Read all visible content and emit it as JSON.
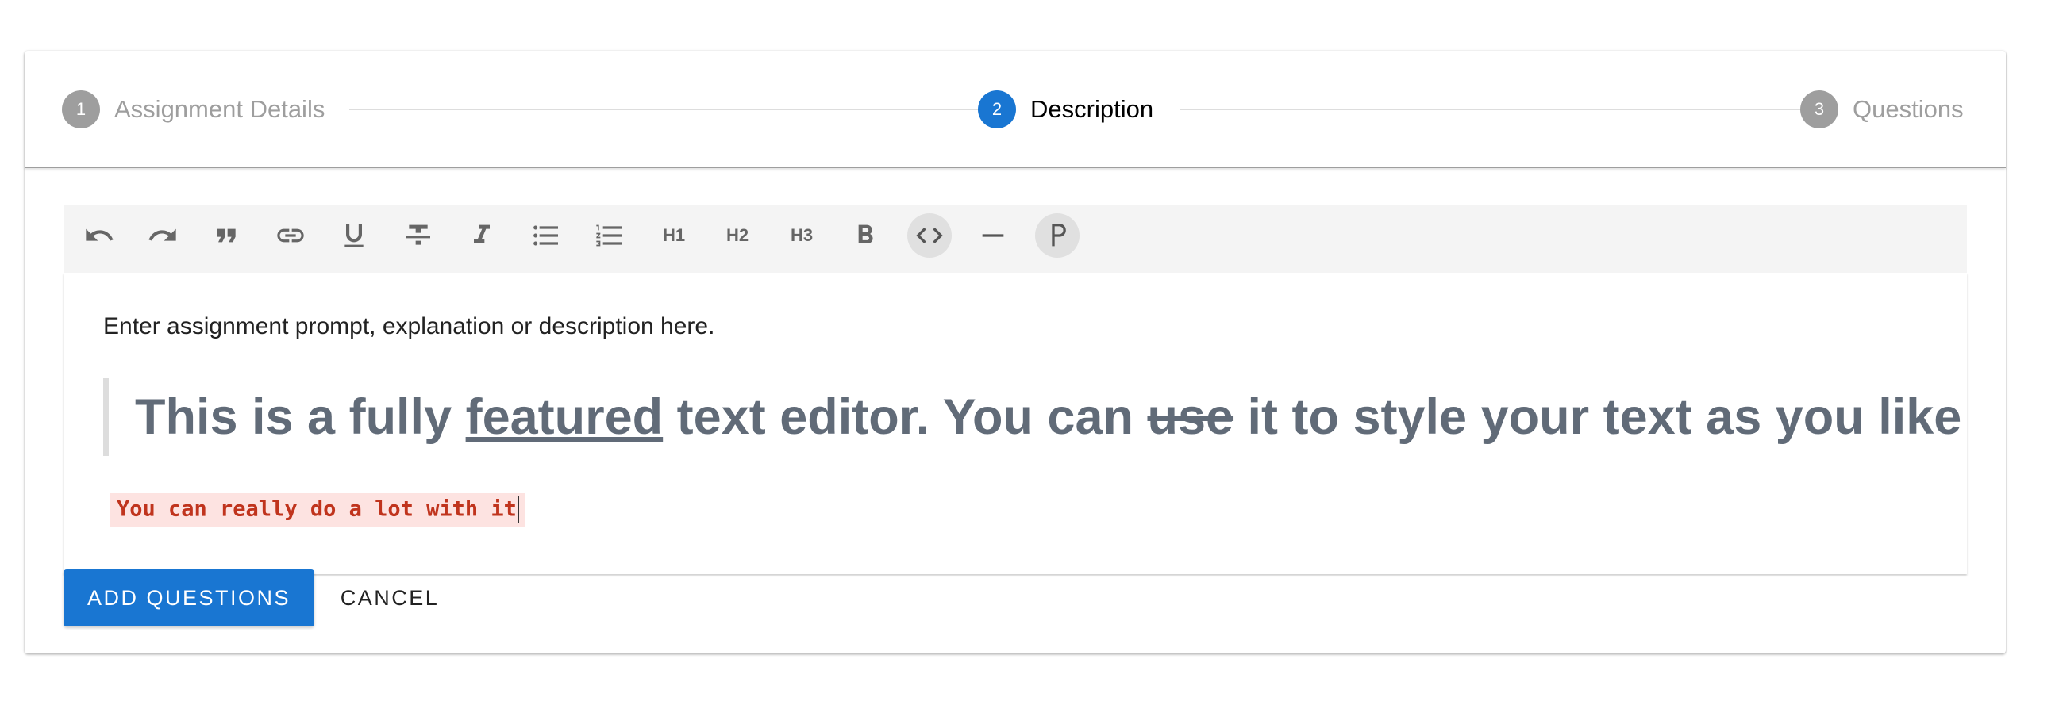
{
  "stepper": {
    "steps": [
      {
        "number": "1",
        "label": "Assignment Details",
        "state": "inactive"
      },
      {
        "number": "2",
        "label": "Description",
        "state": "active"
      },
      {
        "number": "3",
        "label": "Questions",
        "state": "inactive"
      }
    ]
  },
  "toolbar": {
    "buttons": [
      {
        "icon": "undo-icon"
      },
      {
        "icon": "redo-icon"
      },
      {
        "icon": "blockquote-icon"
      },
      {
        "icon": "link-icon"
      },
      {
        "icon": "underline-icon"
      },
      {
        "icon": "strikethrough-icon"
      },
      {
        "icon": "italic-icon"
      },
      {
        "icon": "bullet-list-icon"
      },
      {
        "icon": "numbered-list-icon"
      },
      {
        "label": "H1"
      },
      {
        "label": "H2"
      },
      {
        "label": "H3"
      },
      {
        "icon": "bold-icon"
      },
      {
        "icon": "code-icon",
        "active": true
      },
      {
        "icon": "horizontal-rule-icon"
      },
      {
        "icon": "paragraph-icon",
        "active": true
      }
    ]
  },
  "editor": {
    "paragraph": "Enter assignment prompt, explanation or description here.",
    "quote": {
      "part1": "This is a fully ",
      "underlined": "featured",
      "part2": " text editor. You can ",
      "struck": "use",
      "part3": " it to style your text as you like"
    },
    "code_line": "You can really do a lot with it"
  },
  "actions": {
    "primary_label": "ADD QUESTIONS",
    "cancel_label": "CANCEL"
  },
  "colors": {
    "primary": "#1976d2",
    "inactive_step": "#9e9e9e",
    "quote_text": "#616b78",
    "code_text": "#c0341d",
    "code_bg": "#fde3e1"
  }
}
